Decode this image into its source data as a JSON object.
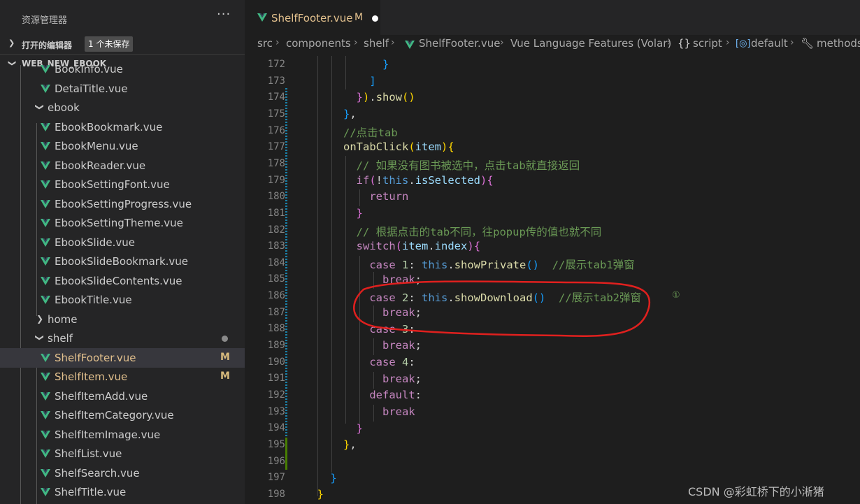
{
  "sidebar": {
    "title": "资源管理器",
    "more": "···",
    "open_editors": {
      "label": "打开的编辑器",
      "badge": "1 个未保存"
    },
    "project": {
      "label": "WEB_NEW_EBOOK"
    },
    "items": [
      {
        "name": "BookInfo.vue",
        "type": "file"
      },
      {
        "name": "DetaiTitle.vue",
        "type": "file"
      },
      {
        "name": "ebook",
        "type": "folder-open"
      },
      {
        "name": "EbookBookmark.vue",
        "type": "file"
      },
      {
        "name": "EbookMenu.vue",
        "type": "file"
      },
      {
        "name": "EbookReader.vue",
        "type": "file"
      },
      {
        "name": "EbookSettingFont.vue",
        "type": "file"
      },
      {
        "name": "EbookSettingProgress.vue",
        "type": "file"
      },
      {
        "name": "EbookSettingTheme.vue",
        "type": "file"
      },
      {
        "name": "EbookSlide.vue",
        "type": "file"
      },
      {
        "name": "EbookSlideBookmark.vue",
        "type": "file"
      },
      {
        "name": "EbookSlideContents.vue",
        "type": "file"
      },
      {
        "name": "EbookTitle.vue",
        "type": "file"
      },
      {
        "name": "home",
        "type": "folder-closed"
      },
      {
        "name": "shelf",
        "type": "folder-open"
      },
      {
        "name": "ShelfFooter.vue",
        "type": "file",
        "status": "M"
      },
      {
        "name": "ShelfItem.vue",
        "type": "file",
        "status": "M"
      },
      {
        "name": "ShelfItemAdd.vue",
        "type": "file"
      },
      {
        "name": "ShelfItemCategory.vue",
        "type": "file"
      },
      {
        "name": "ShelfItemImage.vue",
        "type": "file"
      },
      {
        "name": "ShelfList.vue",
        "type": "file"
      },
      {
        "name": "ShelfSearch.vue",
        "type": "file"
      },
      {
        "name": "ShelfTitle.vue",
        "type": "file"
      }
    ]
  },
  "editor": {
    "tab": {
      "name": "ShelfFooter.vue",
      "status": "M"
    },
    "breadcrumb": [
      "src",
      "components",
      "shelf",
      "ShelfFooter.vue",
      "Vue Language Features (Volar)",
      "script",
      "default",
      "methods"
    ],
    "line_numbers": [
      "172",
      "173",
      "174",
      "175",
      "176",
      "177",
      "178",
      "179",
      "180",
      "181",
      "182",
      "183",
      "184",
      "185",
      "186",
      "187",
      "188",
      "189",
      "190",
      "191",
      "192",
      "193",
      "194",
      "195",
      "196",
      "197",
      "198"
    ],
    "annotation_marker": "①"
  },
  "watermark": "CSDN @彩虹桥下的小淅猪",
  "colors": {
    "vue_green": "#41b883",
    "modified": "#e2c08d",
    "annotation": "#e0201e"
  },
  "icons": {
    "file": "vue-file-icon",
    "folder": "chevron-icon",
    "more": "ellipsis-icon"
  }
}
